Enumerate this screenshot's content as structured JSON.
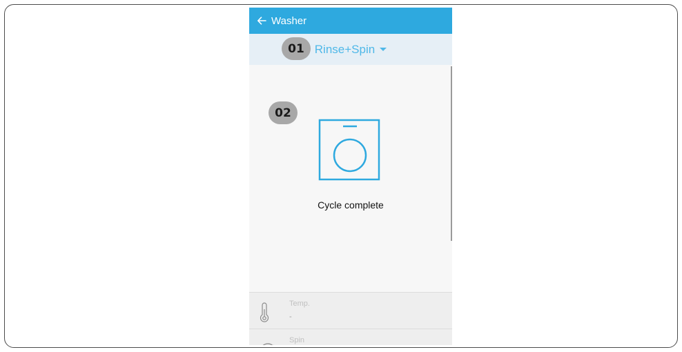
{
  "appbar": {
    "title": "Washer",
    "back_icon": "arrow-left-icon"
  },
  "program": {
    "selected": "Rinse+Spin",
    "dropdown_icon": "caret-down-icon"
  },
  "status": {
    "text": "Cycle complete",
    "icon": "washing-machine-icon"
  },
  "settings": [
    {
      "label": "Temp.",
      "value": "-",
      "icon": "thermometer-icon"
    },
    {
      "label": "Spin",
      "value": "",
      "icon": "spin-icon"
    }
  ],
  "callouts": [
    "01",
    "02"
  ],
  "colors": {
    "appbar": "#2ea9df",
    "accent": "#4fb8e8",
    "program_bar": "#e6eff6",
    "badge": "#a8a8a8"
  }
}
